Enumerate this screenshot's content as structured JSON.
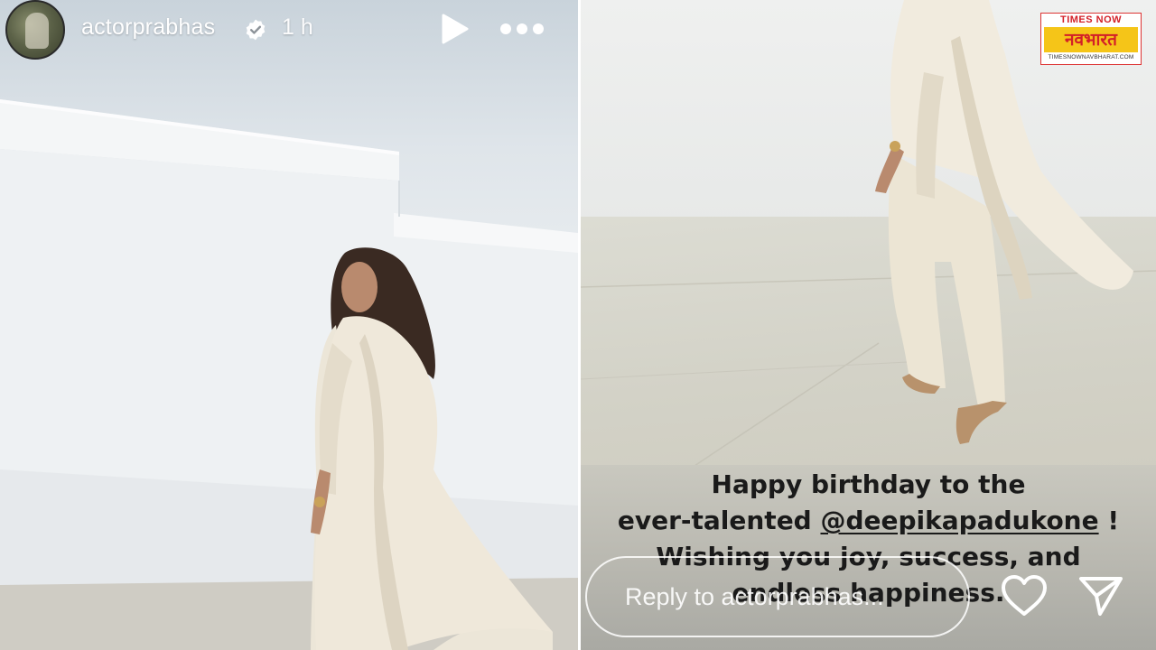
{
  "story": {
    "username": "actorprabhas",
    "time": "1 h"
  },
  "caption": {
    "line1": "Happy birthday to the",
    "line2_prefix": "ever-talented ",
    "mention": "@deepikapadukone",
    "line2_suffix": " !",
    "line3": "Wishing you joy, success, and",
    "line4": "endless happiness."
  },
  "reply": {
    "placeholder": "Reply to actorprabhas..."
  },
  "watermark": {
    "brand_top": "TIMES NOW",
    "brand_main": "नवभारत",
    "brand_url": "TIMESNOWNAVBHARAT.COM"
  },
  "colors": {
    "header_text": "#ffffff",
    "caption_text": "#1a1a1a",
    "logo_red": "#d32028",
    "logo_yellow": "#f5c518"
  },
  "icons": [
    "verified-icon",
    "play-icon",
    "more-icon",
    "heart-icon",
    "send-icon"
  ]
}
